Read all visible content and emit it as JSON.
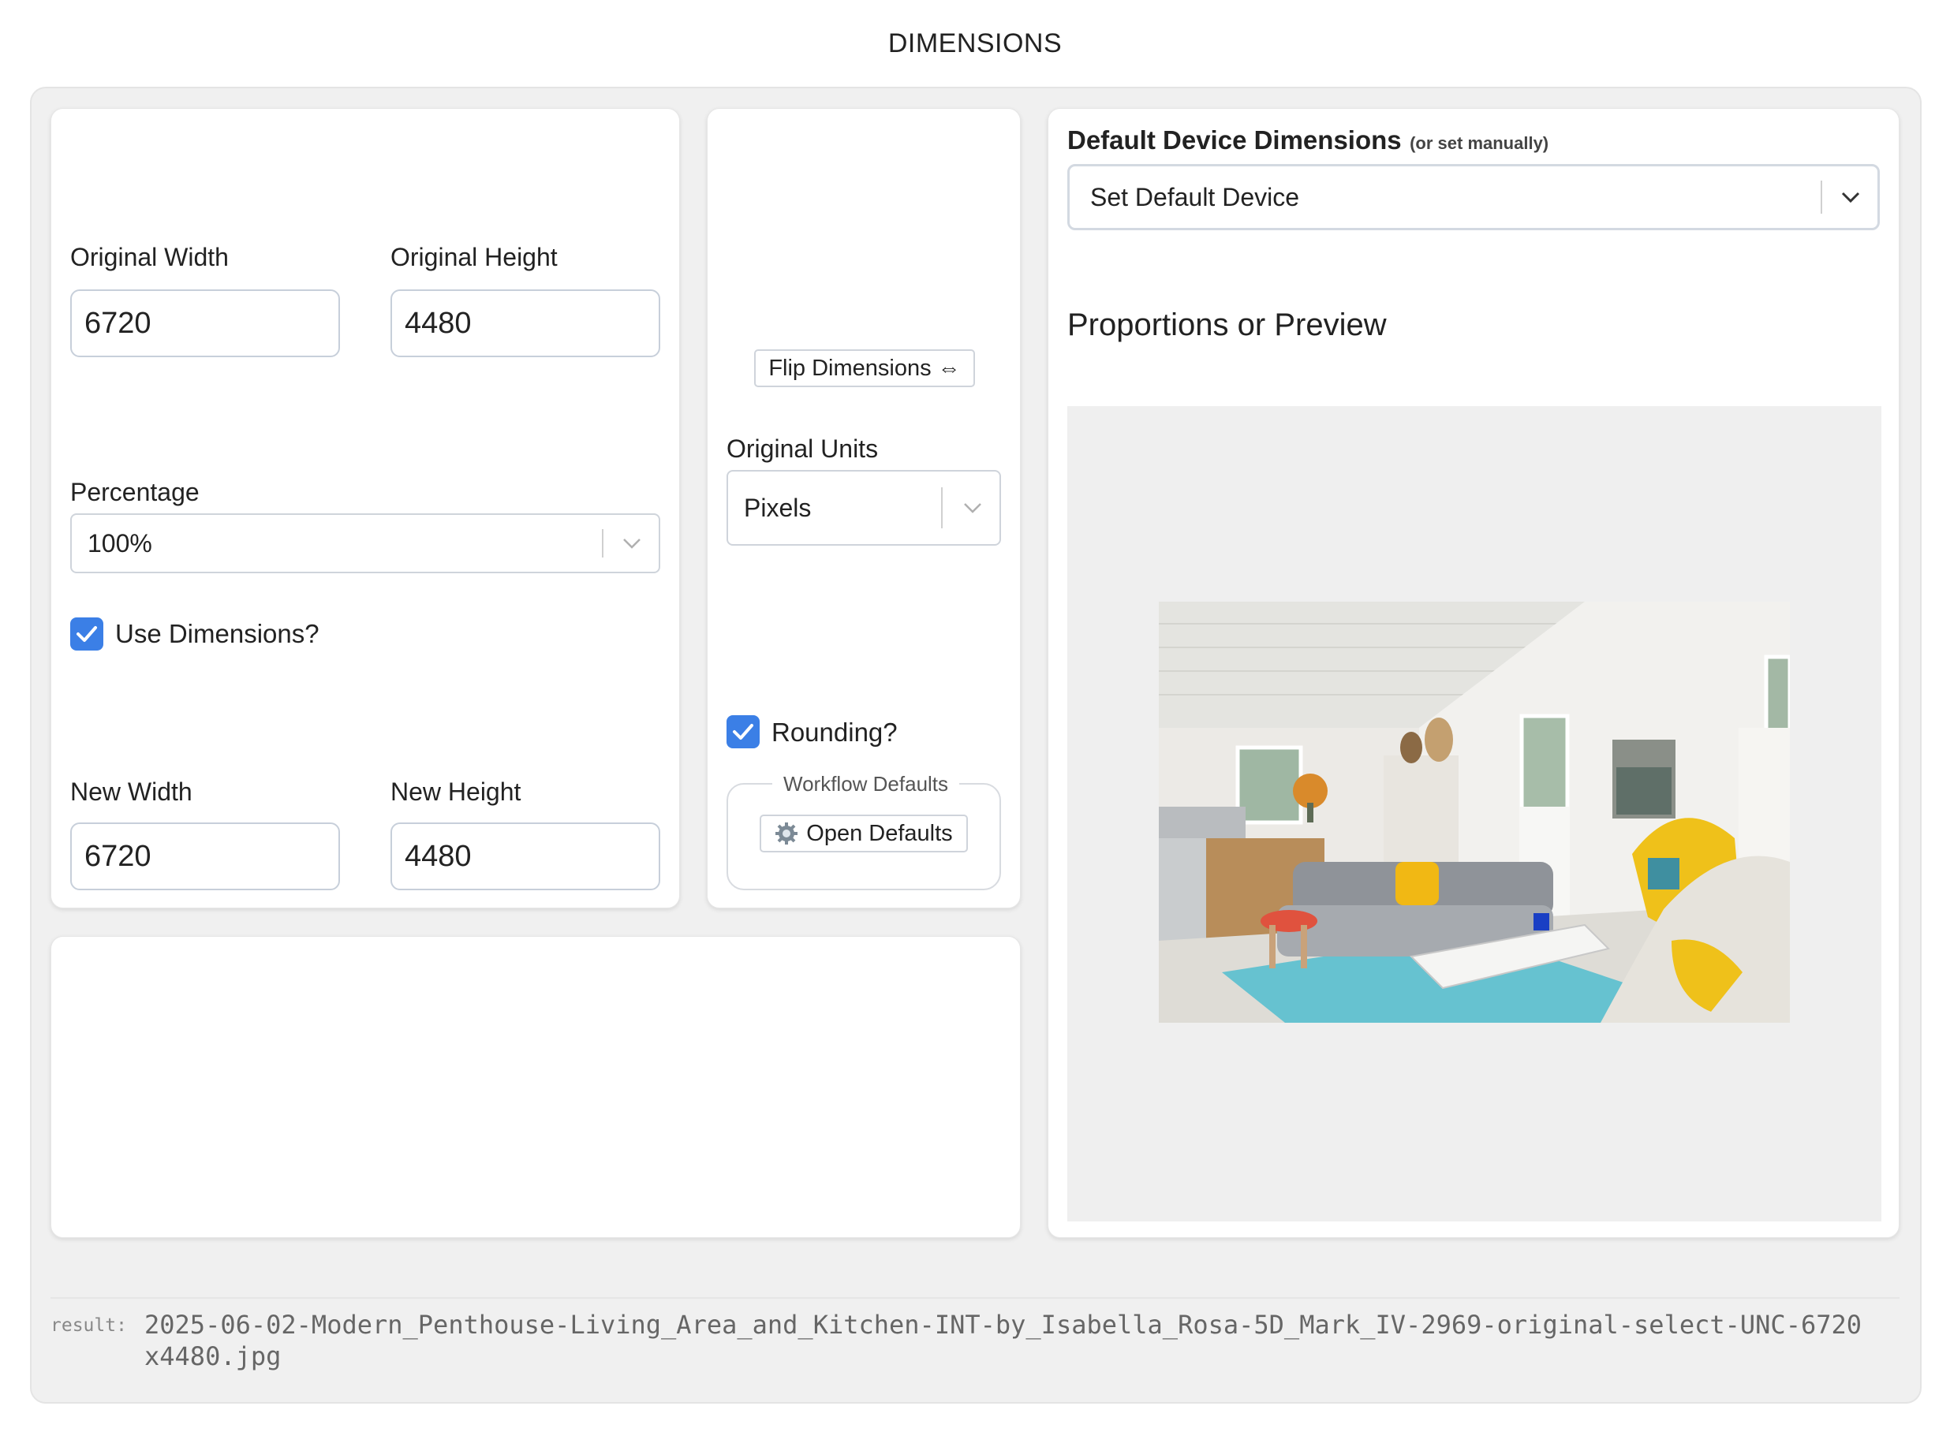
{
  "page": {
    "title": "DIMENSIONS"
  },
  "original": {
    "width_label": "Original Width",
    "height_label": "Original Height",
    "width_value": "6720",
    "height_value": "4480"
  },
  "percentage": {
    "label": "Percentage",
    "selected": "100%"
  },
  "use_dimensions": {
    "label": "Use Dimensions?",
    "checked": true
  },
  "new_dims": {
    "width_label": "New Width",
    "height_label": "New Height",
    "width_value": "6720",
    "height_value": "4480"
  },
  "flip": {
    "label": "Flip Dimensions ⇔"
  },
  "units": {
    "label": "Original Units",
    "selected": "Pixels"
  },
  "rounding": {
    "label": "Rounding?",
    "checked": true
  },
  "workflow": {
    "legend": "Workflow Defaults",
    "button_label": "Open Defaults",
    "button_icon": "gear-icon"
  },
  "device": {
    "title": "Default Device Dimensions",
    "subtitle": "(or set manually)",
    "selected": "Set Default Device"
  },
  "preview": {
    "title": "Proportions or Preview"
  },
  "result": {
    "label": "result:",
    "value": "2025-06-02-Modern_Penthouse-Living_Area_and_Kitchen-INT-by_Isabella_Rosa-5D_Mark_IV-2969-original-select-UNC-6720x4480.jpg"
  },
  "colors": {
    "accent": "#3b7fe6",
    "panel": "#f0f0f0",
    "input_border": "#c7cfda"
  }
}
